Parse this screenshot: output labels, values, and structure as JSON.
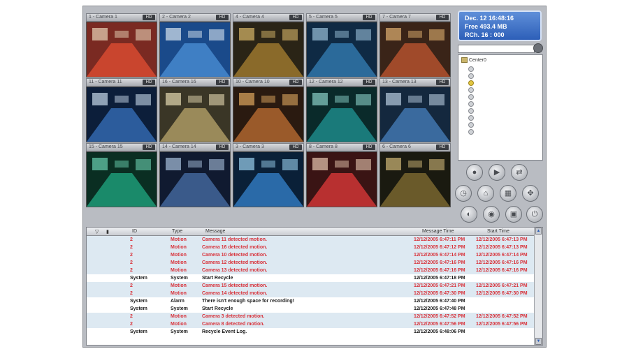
{
  "status": {
    "date_time": "Dec. 12 16:48:16",
    "free": "Free 493.4 MB",
    "rec": "RCh. 16 : 000"
  },
  "cameras": [
    {
      "label": "1 - Camera 1",
      "hd": "HD"
    },
    {
      "label": "2 - Camera 2",
      "hd": "HD"
    },
    {
      "label": "4 - Camera 4",
      "hd": "HD"
    },
    {
      "label": "5 - Camera 5",
      "hd": "HD"
    },
    {
      "label": "7 - Camera 7",
      "hd": "HD"
    },
    {
      "label": "11 - Camera 11",
      "hd": "HD"
    },
    {
      "label": "16 - Camera 16",
      "hd": "HD"
    },
    {
      "label": "10 - Camera 10",
      "hd": "HD"
    },
    {
      "label": "12 - Camera 12",
      "hd": "HD"
    },
    {
      "label": "13 - Camera 13",
      "hd": "HD"
    },
    {
      "label": "15 - Camera 15",
      "hd": "HD"
    },
    {
      "label": "14 - Camera 14",
      "hd": "HD"
    },
    {
      "label": "3 - Camera 3",
      "hd": "HD"
    },
    {
      "label": "8 - Camera 8",
      "hd": "HD"
    },
    {
      "label": "6 - Camera 6",
      "hd": "HD"
    }
  ],
  "tree": {
    "root": "Center0"
  },
  "log": {
    "headers": {
      "id": "ID",
      "type": "Type",
      "message": "Message",
      "message_time": "Message Time",
      "start_time": "Start Time"
    },
    "rows": [
      {
        "id": "2",
        "type": "Motion",
        "message": "Camera 11 detected motion.",
        "mtime": "12/12/2005 6:47:11 PM",
        "stime": "12/12/2005 6:47:13 PM",
        "style": "red",
        "hl": true
      },
      {
        "id": "2",
        "type": "Motion",
        "message": "Camera 16 detected motion.",
        "mtime": "12/12/2005 6:47:12 PM",
        "stime": "12/12/2005 6:47:13 PM",
        "style": "red",
        "hl": true
      },
      {
        "id": "2",
        "type": "Motion",
        "message": "Camera 10 detected motion.",
        "mtime": "12/12/2005 6:47:14 PM",
        "stime": "12/12/2005 6:47:14 PM",
        "style": "red",
        "hl": true
      },
      {
        "id": "2",
        "type": "Motion",
        "message": "Camera 12 detected motion.",
        "mtime": "12/12/2005 6:47:16 PM",
        "stime": "12/12/2005 6:47:16 PM",
        "style": "red",
        "hl": true
      },
      {
        "id": "2",
        "type": "Motion",
        "message": "Camera 13 detected motion.",
        "mtime": "12/12/2005 6:47:16 PM",
        "stime": "12/12/2005 6:47:16 PM",
        "style": "red",
        "hl": true
      },
      {
        "id": "System",
        "type": "System",
        "message": "Start Recycle",
        "mtime": "12/12/2005 6:47:18 PM",
        "stime": "",
        "style": "blk",
        "hl": false
      },
      {
        "id": "2",
        "type": "Motion",
        "message": "Camera 15 detected motion.",
        "mtime": "12/12/2005 6:47:21 PM",
        "stime": "12/12/2005 6:47:21 PM",
        "style": "red",
        "hl": true
      },
      {
        "id": "2",
        "type": "Motion",
        "message": "Camera 14 detected motion.",
        "mtime": "12/12/2005 6:47:30 PM",
        "stime": "12/12/2005 6:47:30 PM",
        "style": "red",
        "hl": true
      },
      {
        "id": "System",
        "type": "Alarm",
        "message": "There isn't enough space for recording!",
        "mtime": "12/12/2005 6:47:40 PM",
        "stime": "",
        "style": "blk",
        "hl": false
      },
      {
        "id": "System",
        "type": "System",
        "message": "Start Recycle",
        "mtime": "12/12/2005 6:47:48 PM",
        "stime": "",
        "style": "blk",
        "hl": false
      },
      {
        "id": "2",
        "type": "Motion",
        "message": "Camera 3 detected motion.",
        "mtime": "12/12/2005 6:47:52 PM",
        "stime": "12/12/2005 6:47:52 PM",
        "style": "red",
        "hl": true
      },
      {
        "id": "2",
        "type": "Motion",
        "message": "Camera 8 detected motion.",
        "mtime": "12/12/2005 6:47:56 PM",
        "stime": "12/12/2005 6:47:56 PM",
        "style": "red",
        "hl": true
      },
      {
        "id": "System",
        "type": "System",
        "message": "Recycle Event Log.",
        "mtime": "12/12/2005 6:48:06 PM",
        "stime": "",
        "style": "blk",
        "hl": false
      }
    ]
  }
}
